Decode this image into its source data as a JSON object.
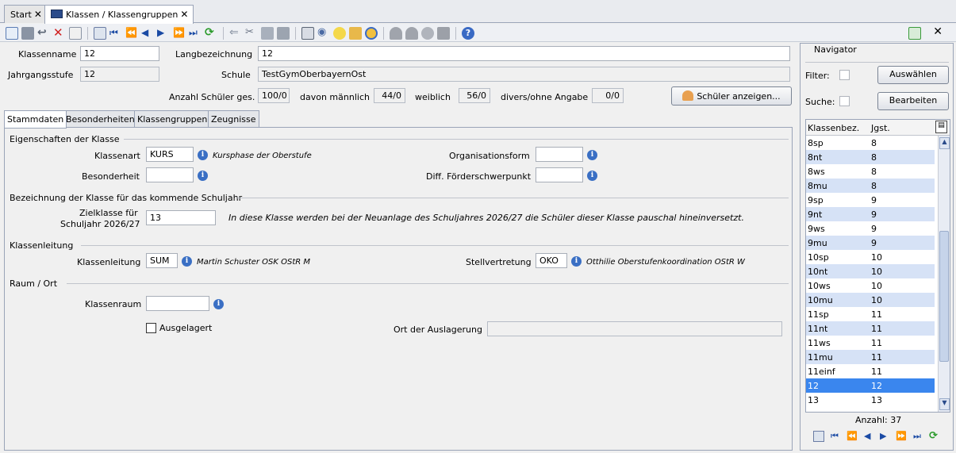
{
  "tabs": [
    {
      "label": "Start"
    },
    {
      "label": "Klassen / Klassengruppen"
    }
  ],
  "header": {
    "klassenname_label": "Klassenname",
    "klassenname_value": "12",
    "langbezeichnung_label": "Langbezeichnung",
    "langbezeichnung_value": "12",
    "jahrgangsstufe_label": "Jahrgangsstufe",
    "jahrgangsstufe_value": "12",
    "schule_label": "Schule",
    "schule_value": "TestGymOberbayernOst",
    "anzahl_label": "Anzahl Schüler ges.",
    "anzahl_value": "100/0",
    "maennlich_label": "davon männlich",
    "maennlich_value": "44/0",
    "weiblich_label": "weiblich",
    "weiblich_value": "56/0",
    "divers_label": "divers/ohne Angabe",
    "divers_value": "0/0",
    "schueler_button": "Schüler anzeigen..."
  },
  "subtabs": [
    "Stammdaten",
    "Besonderheiten",
    "Klassengruppen",
    "Zeugnisse"
  ],
  "stammdaten": {
    "eigenschaften_title": "Eigenschaften der Klasse",
    "klassenart_label": "Klassenart",
    "klassenart_value": "KURS",
    "klassenart_hint": "Kursphase der Oberstufe",
    "organisationsform_label": "Organisationsform",
    "organisationsform_value": "",
    "besonderheit_label": "Besonderheit",
    "besonderheit_value": "",
    "foerder_label": "Diff. Förderschwerpunkt",
    "foerder_value": "",
    "bezeichnung_title": "Bezeichnung der Klasse für das kommende Schuljahr",
    "zielklasse_label_1": "Zielklasse für",
    "zielklasse_label_2": "Schuljahr 2026/27",
    "zielklasse_value": "13",
    "zielklasse_hint": "In diese Klasse werden bei der Neuanlage des Schuljahres 2026/27 die Schüler dieser Klasse pauschal hineinversetzt.",
    "klassenleitung_title": "Klassenleitung",
    "klassenleitung_label": "Klassenleitung",
    "klassenleitung_value": "SUM",
    "klassenleitung_hint": "Martin Schuster OSK OStR M",
    "stellvertretung_label": "Stellvertretung",
    "stellvertretung_value": "OKO",
    "stellvertretung_hint": "Otthilie Oberstufenkoordination OStR W",
    "raum_title": "Raum / Ort",
    "klassenraum_label": "Klassenraum",
    "klassenraum_value": "",
    "ausgelagert_label": "Ausgelagert",
    "ausgelagert_checked": false,
    "ort_label": "Ort der Auslagerung",
    "ort_value": ""
  },
  "navigator": {
    "title": "Navigator",
    "filter_label": "Filter:",
    "suche_label": "Suche:",
    "auswaehlen_button": "Auswählen",
    "bearbeiten_button": "Bearbeiten",
    "col_klassenbez": "Klassenbez.",
    "col_jgst": "Jgst.",
    "rows": [
      {
        "bez": "8sp",
        "jgst": "8"
      },
      {
        "bez": "8nt",
        "jgst": "8"
      },
      {
        "bez": "8ws",
        "jgst": "8"
      },
      {
        "bez": "8mu",
        "jgst": "8"
      },
      {
        "bez": "9sp",
        "jgst": "9"
      },
      {
        "bez": "9nt",
        "jgst": "9"
      },
      {
        "bez": "9ws",
        "jgst": "9"
      },
      {
        "bez": "9mu",
        "jgst": "9"
      },
      {
        "bez": "10sp",
        "jgst": "10"
      },
      {
        "bez": "10nt",
        "jgst": "10"
      },
      {
        "bez": "10ws",
        "jgst": "10"
      },
      {
        "bez": "10mu",
        "jgst": "10"
      },
      {
        "bez": "11sp",
        "jgst": "11"
      },
      {
        "bez": "11nt",
        "jgst": "11"
      },
      {
        "bez": "11ws",
        "jgst": "11"
      },
      {
        "bez": "11mu",
        "jgst": "11"
      },
      {
        "bez": "11einf",
        "jgst": "11"
      },
      {
        "bez": "12",
        "jgst": "12"
      },
      {
        "bez": "13",
        "jgst": "13"
      }
    ],
    "selected_row": "12",
    "anzahl": "Anzahl: 37"
  },
  "colors": {
    "selection": "#3a86ee",
    "alt_row": "#d6e2f6",
    "info_icon": "#3a6fc4"
  }
}
